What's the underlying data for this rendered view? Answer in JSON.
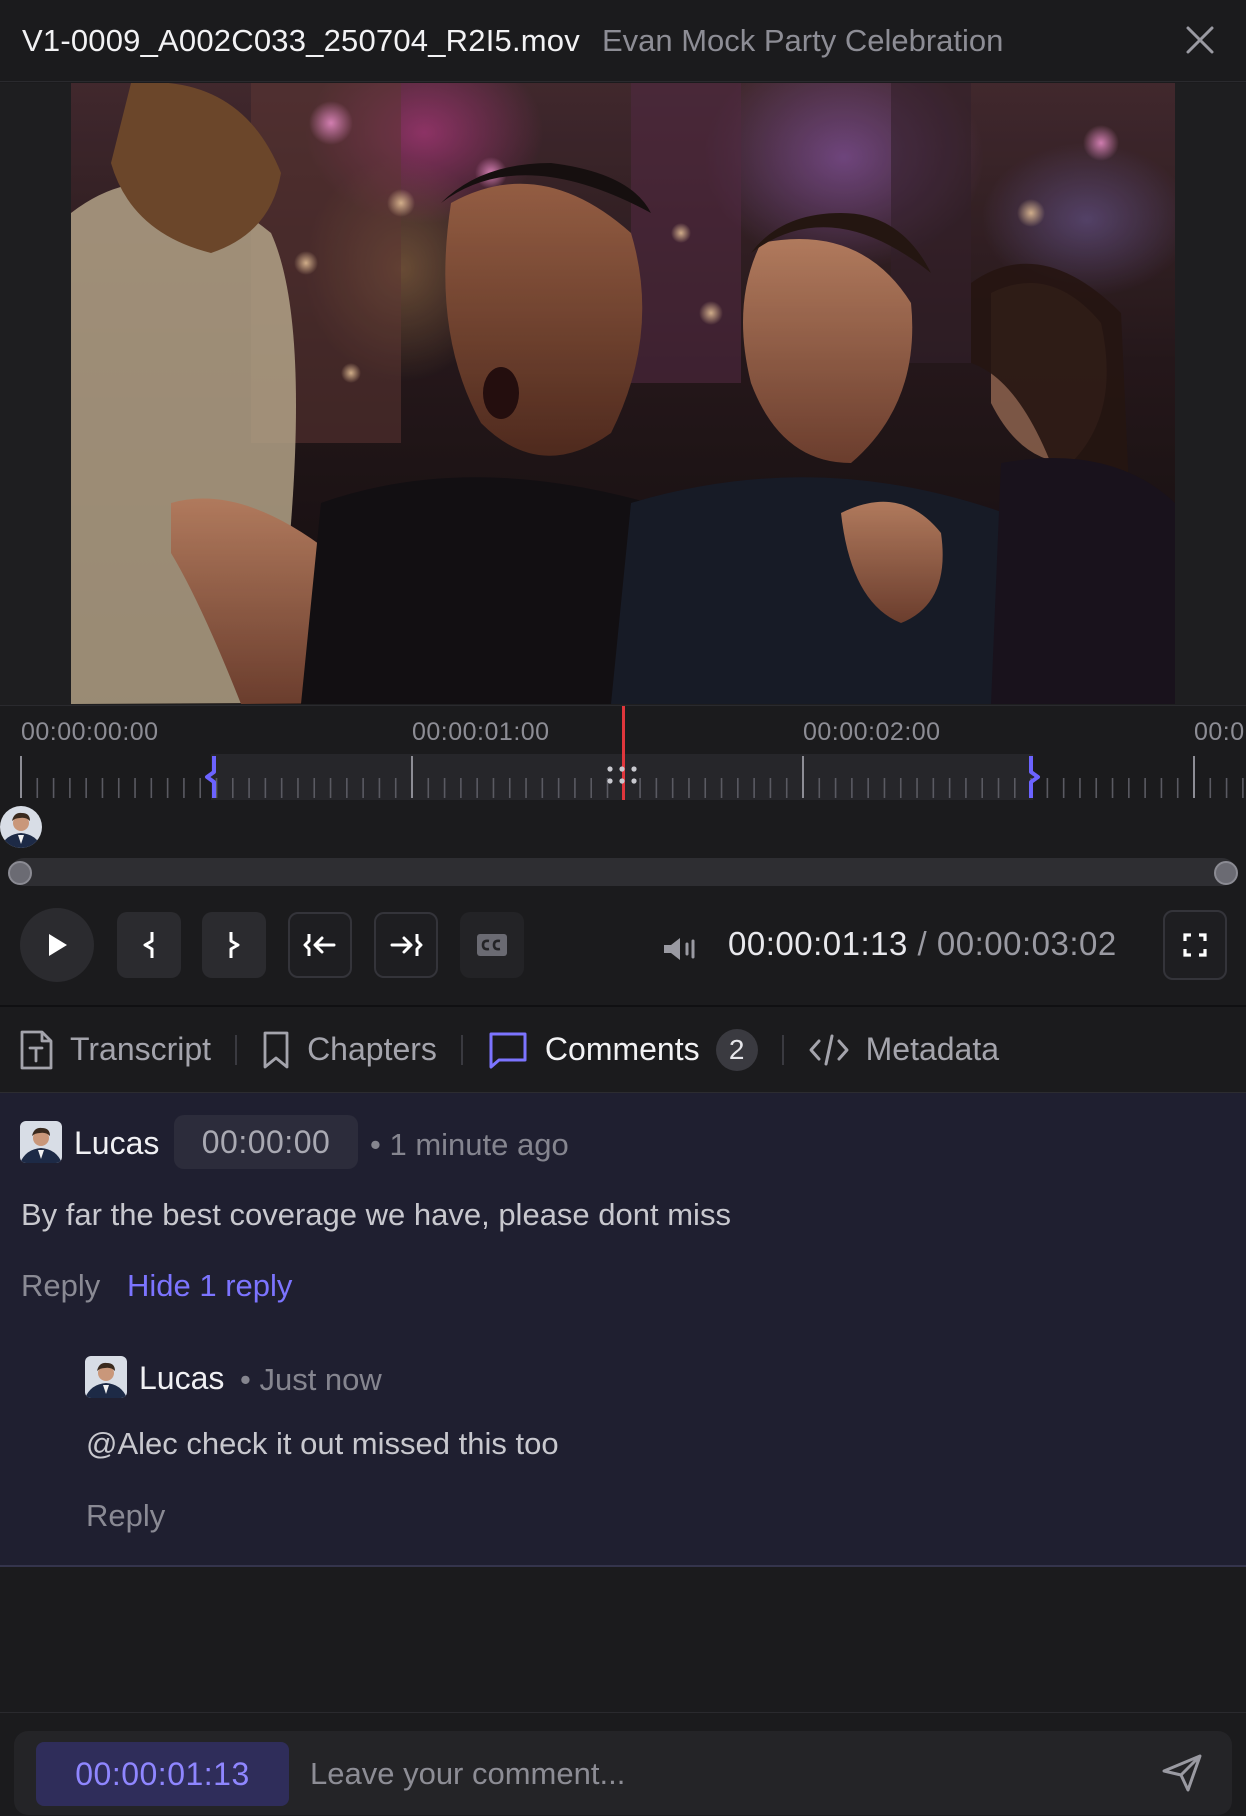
{
  "header": {
    "file_name": "V1-0009_A002C033_250704_R2I5.mov",
    "project_name": "Evan Mock Party Celebration",
    "close_icon": "close-icon"
  },
  "timeline": {
    "labels": [
      "00:00:00:00",
      "00:00:01:00",
      "00:00:02:00",
      "00:0"
    ],
    "playhead_color": "#e0363c",
    "range_marker_color": "#6c63ff"
  },
  "controls": {
    "current_time": "00:00:01:13",
    "separator": "/",
    "duration": "00:00:03:02",
    "icons": [
      "play-icon",
      "mark-in-icon",
      "mark-out-icon",
      "go-to-in-icon",
      "go-to-out-icon",
      "captions-icon",
      "volume-icon",
      "fullscreen-icon"
    ]
  },
  "tabs": [
    {
      "label": "Transcript",
      "icon": "transcript-icon"
    },
    {
      "label": "Chapters",
      "icon": "bookmark-icon"
    },
    {
      "label": "Comments",
      "icon": "comment-icon",
      "badge": "2",
      "active": true
    },
    {
      "label": "Metadata",
      "icon": "code-icon"
    }
  ],
  "comment": {
    "author": "Lucas",
    "timestamp": "00:00:00",
    "time_ago": "• 1 minute ago",
    "body": "By far the best coverage we have, please dont miss",
    "reply_label": "Reply",
    "toggle_label": "Hide 1 reply",
    "reply": {
      "author": "Lucas",
      "time_ago": "• Just now",
      "body": "@Alec check it out missed this too",
      "reply_label": "Reply"
    }
  },
  "composer": {
    "timestamp": "00:00:01:13",
    "placeholder": "Leave your comment...",
    "send_icon": "send-icon"
  },
  "colors": {
    "accent": "#7c74ff",
    "comments_bg": "#1f1f30",
    "app_bg": "#1b1b1d"
  }
}
